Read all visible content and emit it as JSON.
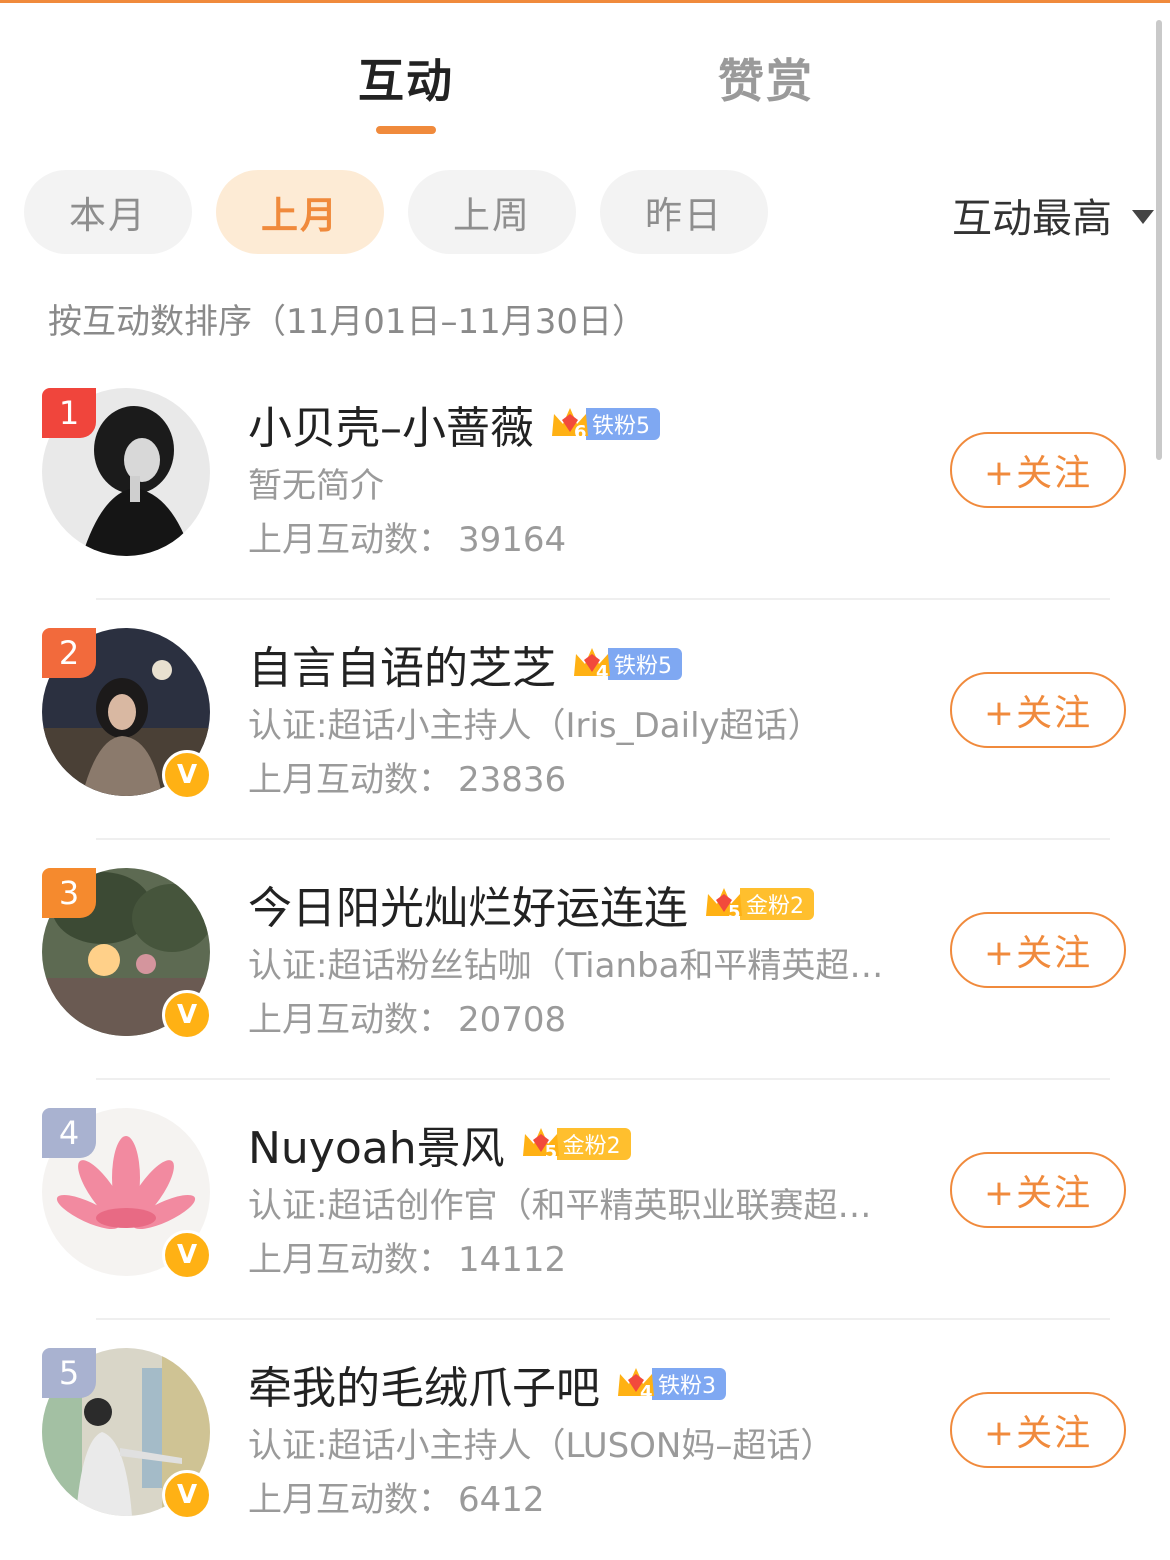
{
  "tabs": [
    {
      "label": "互动",
      "active": true
    },
    {
      "label": "赞赏",
      "active": false
    }
  ],
  "period_filters": [
    {
      "label": "本月",
      "selected": false
    },
    {
      "label": "上月",
      "selected": true
    },
    {
      "label": "上周",
      "selected": false
    },
    {
      "label": "昨日",
      "selected": false
    }
  ],
  "sort_dropdown": {
    "label": "互动最高"
  },
  "range_text": "按互动数排序（11月01日–11月30日）",
  "follow_label": "+关注",
  "colors": {
    "accent": "#f08a3c",
    "iron_fan": "#7fa8f2",
    "gold_fan": "#ffbf2e",
    "verified": "#ffb114"
  },
  "users": [
    {
      "rank": "1",
      "name": "小贝壳–小蔷薇",
      "crown_level": "6",
      "fan_label": "铁粉5",
      "fan_type": "iron",
      "verified": false,
      "desc": "暂无简介",
      "stat_label": "上月互动数：",
      "stat_value": "39164"
    },
    {
      "rank": "2",
      "name": "自言自语的芝芝",
      "crown_level": "4",
      "fan_label": "铁粉5",
      "fan_type": "iron",
      "verified": true,
      "desc": "认证:超话小主持人（Iris_Daily超话）",
      "stat_label": "上月互动数：",
      "stat_value": "23836"
    },
    {
      "rank": "3",
      "name": "今日阳光灿烂好运连连",
      "crown_level": "5",
      "fan_label": "金粉2",
      "fan_type": "gold",
      "verified": true,
      "desc": "认证:超话粉丝钻咖（Tianba和平精英超…",
      "stat_label": "上月互动数：",
      "stat_value": "20708"
    },
    {
      "rank": "4",
      "name": "Nuyoah景风",
      "crown_level": "5",
      "fan_label": "金粉2",
      "fan_type": "gold",
      "verified": true,
      "desc": "认证:超话创作官（和平精英职业联赛超…",
      "stat_label": "上月互动数：",
      "stat_value": "14112"
    },
    {
      "rank": "5",
      "name": "牵我的毛绒爪子吧",
      "crown_level": "4",
      "fan_label": "铁粉3",
      "fan_type": "iron",
      "verified": true,
      "desc": "认证:超话小主持人（LUSON妈–超话）",
      "stat_label": "上月互动数：",
      "stat_value": "6412"
    }
  ]
}
